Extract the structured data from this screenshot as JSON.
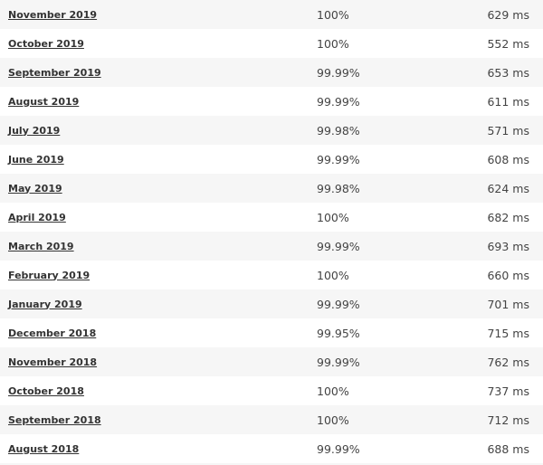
{
  "rows": [
    {
      "month": "November 2019",
      "uptime": "100%",
      "response": "629 ms"
    },
    {
      "month": "October 2019",
      "uptime": "100%",
      "response": "552 ms"
    },
    {
      "month": "September 2019",
      "uptime": "99.99%",
      "response": "653 ms"
    },
    {
      "month": "August 2019",
      "uptime": "99.99%",
      "response": "611 ms"
    },
    {
      "month": "July 2019",
      "uptime": "99.98%",
      "response": "571 ms"
    },
    {
      "month": "June 2019",
      "uptime": "99.99%",
      "response": "608 ms"
    },
    {
      "month": "May 2019",
      "uptime": "99.98%",
      "response": "624 ms"
    },
    {
      "month": "April 2019",
      "uptime": "100%",
      "response": "682 ms"
    },
    {
      "month": "March 2019",
      "uptime": "99.99%",
      "response": "693 ms"
    },
    {
      "month": "February 2019",
      "uptime": "100%",
      "response": "660 ms"
    },
    {
      "month": "January 2019",
      "uptime": "99.99%",
      "response": "701 ms"
    },
    {
      "month": "December 2018",
      "uptime": "99.95%",
      "response": "715 ms"
    },
    {
      "month": "November 2018",
      "uptime": "99.99%",
      "response": "762 ms"
    },
    {
      "month": "October 2018",
      "uptime": "100%",
      "response": "737 ms"
    },
    {
      "month": "September 2018",
      "uptime": "100%",
      "response": "712 ms"
    },
    {
      "month": "August 2018",
      "uptime": "99.99%",
      "response": "688 ms"
    }
  ]
}
